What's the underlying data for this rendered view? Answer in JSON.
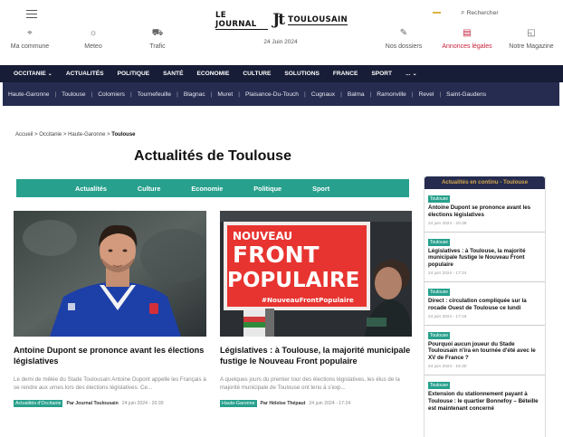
{
  "header": {
    "logo_left": "LE JOURNAL",
    "logo_mark": "Jt",
    "logo_right": "TOULOUSAIN",
    "date": "24 Juin 2024",
    "search_placeholder": "Rechercher",
    "utils_left": [
      {
        "label": "Ma commune",
        "icon": "map-pin-icon"
      },
      {
        "label": "Meteo",
        "icon": "weather-icon"
      },
      {
        "label": "Trafic",
        "icon": "car-icon"
      }
    ],
    "utils_right": [
      {
        "label": "Nos dossiers",
        "icon": "pen-icon"
      },
      {
        "label": "Annonces légales",
        "icon": "document-icon"
      },
      {
        "label": "Notre Magazine",
        "icon": "magazine-icon"
      }
    ]
  },
  "nav": {
    "items": [
      "OCCITANIE",
      "ACTUALITÉS",
      "POLITIQUE",
      "SANTÉ",
      "ECONOMIE",
      "CULTURE",
      "SOLUTIONS",
      "FRANCE",
      "SPORT",
      "..."
    ]
  },
  "subnav": {
    "items": [
      "Haute-Garonne",
      "Toulouse",
      "Colomiers",
      "Tournefeuille",
      "Blagnac",
      "Muret",
      "Plaisance-Du-Touch",
      "Cugnaux",
      "Balma",
      "Ramonville",
      "Revel",
      "Saint-Gaudens"
    ]
  },
  "breadcrumb": {
    "items": [
      "Accueil",
      "Occitanie",
      "Haute-Garonne"
    ],
    "current": "Toulouse",
    "separator": ">"
  },
  "page_title": "Actualités de Toulouse",
  "tabs": [
    "Actualités",
    "Culture",
    "Economie",
    "Politique",
    "Sport"
  ],
  "articles": [
    {
      "title": "Antoine Dupont se prononce avant les élections législatives",
      "excerpt": "Le demi de mêlée du Stade Toulousain Antoine Dupont appelle les Français à se rendre aux urnes lors des élections législatives. Ce...",
      "tag": "Actualités d'Occitanie",
      "author": "Par Journal Toulousain",
      "time": "24 juin 2024 - 20:39"
    },
    {
      "title": "Législatives : à Toulouse, la majorité municipale fustige le Nouveau Front populaire",
      "excerpt": "A quelques jours du premier tour des élections législatives, les élus de la majorité municipale de Toulouse ont tenu à s'exp...",
      "tag": "Haute-Garonne",
      "author": "Par Héloïse Thépaut",
      "time": "24 juin 2024 - 17:24",
      "poster_line1": "NOUVEAU",
      "poster_line2": "FRONT",
      "poster_line3": "POPULAIRE",
      "poster_hashtag": "#NouveauFrontPopulaire"
    }
  ],
  "sidebar": {
    "heading": "Actualités en continu - Toulouse",
    "items": [
      {
        "tag": "Toulouse",
        "title": "Antoine Dupont se prononce avant les élections législatives",
        "time": "24 juin 2024 - 20:39"
      },
      {
        "tag": "Toulouse",
        "title": "Législatives : à Toulouse, la majorité municipale fustige le Nouveau Front populaire",
        "time": "24 juin 2024 - 17:24"
      },
      {
        "tag": "Toulouse",
        "title": "Direct : circulation compliquée sur la rocade Ouest de Toulouse ce lundi",
        "time": "24 juin 2024 - 17:15"
      },
      {
        "tag": "Toulouse",
        "title": "Pourquoi aucun joueur du Stade Toulousain n'ira en tournée d'été avec le XV de France ?",
        "time": "24 juin 2024 - 16:30"
      },
      {
        "tag": "Toulouse",
        "title": "Extension du stationnement payant à Toulouse : le quartier Bonnefoy – Béteille est maintenant concerné",
        "time": ""
      }
    ]
  },
  "colors": {
    "navy": "#171d36",
    "subnav": "#262c50",
    "teal": "#27a08d",
    "accent_red": "#c51f38",
    "gold": "#d4a74a"
  }
}
